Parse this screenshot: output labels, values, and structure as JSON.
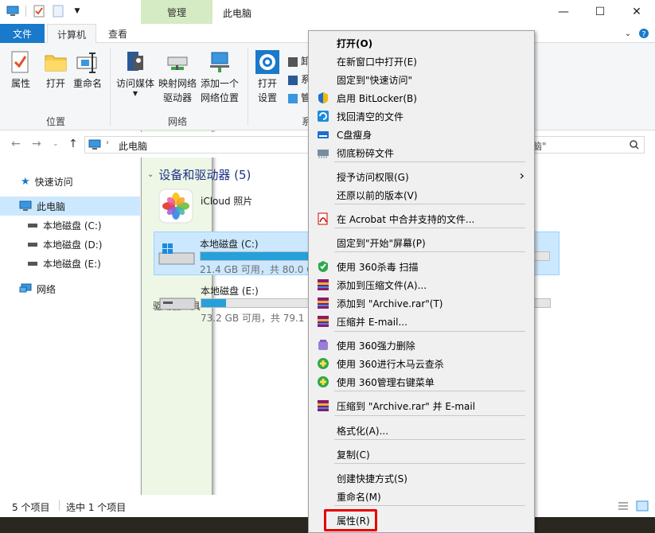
{
  "title": {
    "context_tab_header": "管理",
    "window_title": "此电脑"
  },
  "tabs": [
    "文件",
    "计算机",
    "查看",
    "驱动器工具"
  ],
  "ribbon": {
    "buttons": [
      {
        "label": "属性",
        "icon": "properties-icon"
      },
      {
        "label": "打开",
        "icon": "open-folder-icon"
      },
      {
        "label": "重命名",
        "icon": "rename-icon"
      },
      {
        "label": "访问媒体",
        "icon": "media-icon"
      },
      {
        "label": "映射网络\n驱动器",
        "icon": "map-drive-icon"
      },
      {
        "label": "添加一个\n网络位置",
        "icon": "network-location-icon"
      },
      {
        "label": "打开\n设置",
        "icon": "settings-gear-icon"
      }
    ],
    "groups": [
      "位置",
      "网络"
    ],
    "right_partial": [
      "卸",
      "系",
      "管",
      "系"
    ]
  },
  "address": {
    "path": "此电脑",
    "search_partial": "脑\""
  },
  "sidebar": {
    "items": [
      {
        "label": "快速访问",
        "icon": "star-icon"
      },
      {
        "label": "此电脑",
        "icon": "computer-icon"
      },
      {
        "label": "本地磁盘 (C:)",
        "icon": "drive-icon"
      },
      {
        "label": "本地磁盘 (D:)",
        "icon": "drive-icon"
      },
      {
        "label": "本地磁盘 (E:)",
        "icon": "drive-icon"
      },
      {
        "label": "网络",
        "icon": "network-icon"
      }
    ]
  },
  "main": {
    "section_title": "设备和驱动器 (5)",
    "drives": [
      {
        "name": "iCloud 照片",
        "sub": "",
        "usage": null
      },
      {
        "name": "本地磁盘 (C:)",
        "sub": "21.4 GB 可用，共 80.0 G",
        "usage": 0.73
      },
      {
        "name": "本地磁盘 (E:)",
        "sub": "73.2 GB 可用，共 79.1 G",
        "usage": 0.07
      }
    ]
  },
  "status": {
    "items_count": "5 个项目",
    "selected": "选中 1 个项目"
  },
  "context_menu": {
    "items": [
      {
        "label": "打开(O)",
        "icon": "",
        "bold": true
      },
      {
        "label": "在新窗口中打开(E)",
        "icon": ""
      },
      {
        "label": "固定到\"快速访问\"",
        "icon": ""
      },
      {
        "label": "启用 BitLocker(B)",
        "icon": "shield-icon"
      },
      {
        "label": "找回清空的文件",
        "icon": "recover-icon"
      },
      {
        "label": "C盘瘦身",
        "icon": "c-slim-icon"
      },
      {
        "label": "彻底粉碎文件",
        "icon": "shred-icon"
      },
      {
        "label": "授予访问权限(G)",
        "icon": "",
        "submenu": true
      },
      {
        "label": "还原以前的版本(V)",
        "icon": ""
      },
      {
        "label": "在 Acrobat 中合并支持的文件...",
        "icon": "acrobat-icon"
      },
      {
        "label": "固定到\"开始\"屏幕(P)",
        "icon": ""
      },
      {
        "label": "使用 360杀毒 扫描",
        "icon": "360-antivirus-icon"
      },
      {
        "label": "添加到压缩文件(A)...",
        "icon": "winrar-icon"
      },
      {
        "label": "添加到 \"Archive.rar\"(T)",
        "icon": "winrar-icon"
      },
      {
        "label": "压缩并 E-mail...",
        "icon": "winrar-icon"
      },
      {
        "label": "使用 360强力删除",
        "icon": "360-delete-icon"
      },
      {
        "label": "使用 360进行木马云查杀",
        "icon": "360-trojan-icon"
      },
      {
        "label": "使用 360管理右键菜单",
        "icon": "360-menu-icon"
      },
      {
        "label": "压缩到 \"Archive.rar\" 并 E-mail",
        "icon": "winrar-icon"
      },
      {
        "label": "格式化(A)...",
        "icon": ""
      },
      {
        "label": "复制(C)",
        "icon": ""
      },
      {
        "label": "创建快捷方式(S)",
        "icon": ""
      },
      {
        "label": "重命名(M)",
        "icon": ""
      },
      {
        "label": "属性(R)",
        "icon": "",
        "highlighted": true
      }
    ]
  },
  "colors": {
    "file_tab": "#1979ca",
    "context_tab": "#d5ebc3",
    "selection": "#cce8ff",
    "progress": "#26a0da",
    "highlight_box": "#e60000"
  }
}
